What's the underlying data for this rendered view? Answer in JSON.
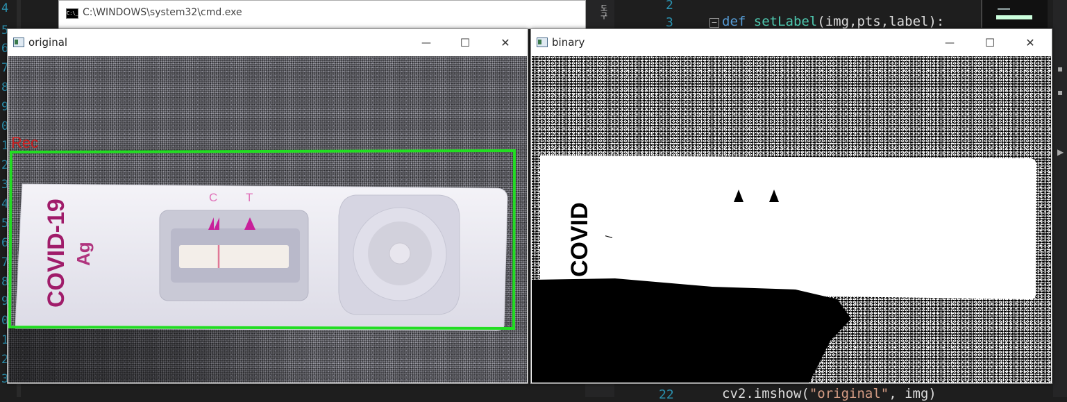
{
  "left_gutter": {
    "line_digits": [
      "4",
      "5",
      "6",
      "7",
      "8",
      "9",
      "0",
      "1",
      "2",
      "3",
      "4",
      "5",
      "6",
      "7",
      "8",
      "9",
      "0",
      "1",
      "2",
      "3"
    ]
  },
  "editor": {
    "side_hint": "도구",
    "line_numbers": [
      "2",
      "3"
    ],
    "fold_glyph": "−",
    "code_line_def": {
      "keyword": "def",
      "name": "setLabel",
      "params": "(img,pts,label):"
    },
    "code_line_bottom_num": "22",
    "code_line_bottom": {
      "call": "cv2.imshow(",
      "arg1": "\"original\"",
      "rest": ", img)"
    }
  },
  "cmd_window": {
    "title": "C:\\WINDOWS\\system32\\cmd.exe",
    "icon_text": "C:\\_"
  },
  "windows": [
    {
      "id": "original",
      "title": "original"
    },
    {
      "id": "binary",
      "title": "binary"
    }
  ],
  "window_controls": {
    "minimize": "—",
    "maximize": "☐",
    "close": "✕"
  },
  "original_image": {
    "label_text": "Rec",
    "box_color": "#22dd22",
    "label_color": "#d02020",
    "kit_text_main": "COVID-19",
    "kit_text_sub": "Ag",
    "marker_c": "C",
    "marker_t": "T",
    "accent_color": "#c8209a"
  },
  "binary_image": {
    "kit_text": "COVID"
  }
}
